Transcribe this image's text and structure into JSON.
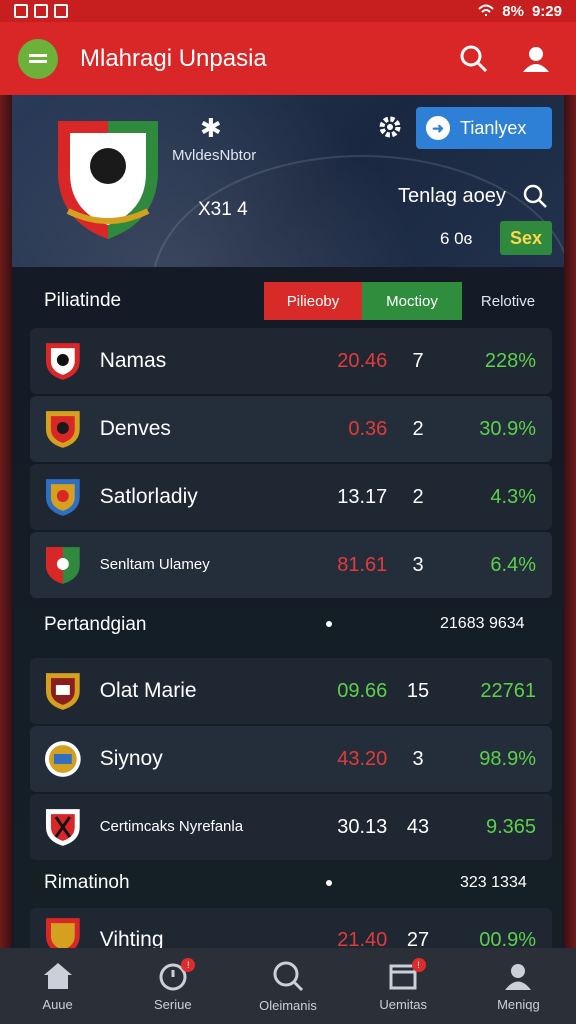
{
  "status_bar": {
    "left": "T4I",
    "battery": "8%",
    "time": "9:29"
  },
  "app_bar": {
    "title": "Mlahragi Unpasia"
  },
  "hero": {
    "subtitle": "MvldesNbtor",
    "score": "X31 4",
    "cta_label": "Tianlyex",
    "label": "Tenlag aoey",
    "number": "6 0ɞ",
    "badge": "Sex"
  },
  "standings": {
    "title": "Piliatinde",
    "segments": [
      "Pilieoby",
      "Moctioy",
      "Relotive"
    ],
    "rows": [
      {
        "name": "Namas",
        "value": "20.46",
        "value_color": "red",
        "count": "7",
        "pct": "228%"
      },
      {
        "name": "Denves",
        "value": "0.36",
        "value_color": "red",
        "count": "2",
        "pct": "30.9%"
      },
      {
        "name": "Satlorladiy",
        "value": "13.17",
        "value_color": "white",
        "count": "2",
        "pct": "4.3%"
      },
      {
        "name": "Senltam Ulamey",
        "value": "81.61",
        "value_color": "red",
        "count": "3",
        "pct": "6.4%"
      }
    ]
  },
  "matches": {
    "title": "Pertandgian",
    "value": "21683 9634",
    "rows": [
      {
        "name": "Olat Marie",
        "value": "09.66",
        "value_color": "green",
        "count": "15",
        "pct": "22761"
      },
      {
        "name": "Siynoy",
        "value": "43.20",
        "value_color": "red",
        "count": "3",
        "pct": "98.9%"
      },
      {
        "name": "Certimcaks Nyrefanla",
        "value": "30.13",
        "value_color": "white",
        "count": "43",
        "pct": "9.365"
      }
    ]
  },
  "results": {
    "title": "Rimatinoh",
    "value": "323 1334",
    "rows": [
      {
        "name": "Vihting",
        "value": "21.40",
        "value_color": "red",
        "count": "27",
        "pct": "00.9%"
      }
    ]
  },
  "bottom_nav": [
    {
      "label": "Auue",
      "icon": "home-icon"
    },
    {
      "label": "Seriue",
      "icon": "stopwatch-icon"
    },
    {
      "label": "Oleimanis",
      "icon": "search-icon"
    },
    {
      "label": "Uemitas",
      "icon": "calendar-icon"
    },
    {
      "label": "Meniqg",
      "icon": "profile-icon"
    }
  ]
}
